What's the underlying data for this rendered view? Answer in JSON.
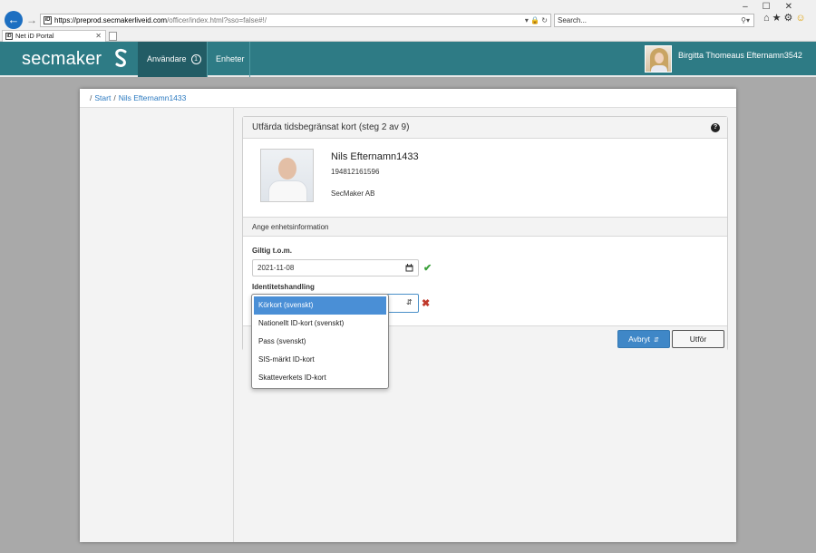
{
  "browser": {
    "url_host": "https://preprod.secmakerliveid.com",
    "url_path": "/officer/index.html?sso=false#!/",
    "search_placeholder": "Search...",
    "tab_title": "Net iD Portal",
    "site_icon_text": "iD"
  },
  "header": {
    "logo_text": "secmaker",
    "nav": [
      {
        "label": "Användare",
        "count": "1"
      },
      {
        "label": "Enheter"
      }
    ],
    "user_name": "Birgitta Thomeaus Efternamn3542"
  },
  "breadcrumb": {
    "items": [
      "Start",
      "Nils Efternamn1433"
    ]
  },
  "panel": {
    "title": "Utfärda tidsbegränsat kort (steg 2 av 9)",
    "help_glyph": "?",
    "person": {
      "name": "Nils Efternamn1433",
      "id_number": "194812161596",
      "organization": "SecMaker AB"
    },
    "section_title": "Ange enhetsinformation",
    "valid_label": "Giltig t.o.m.",
    "valid_value": "2021-11-08",
    "doc_label": "Identitetshandling",
    "buttons": {
      "cancel": "Avbryt",
      "execute": "Utför"
    }
  },
  "dropdown": {
    "options": [
      "Körkort (svenskt)",
      "Nationellt ID-kort (svenskt)",
      "Pass (svenskt)",
      "SIS-märkt ID-kort",
      "Skatteverkets ID-kort"
    ],
    "selected_index": 0
  },
  "colors": {
    "header_bg": "#2e7b85",
    "accent_blue": "#3f87c7",
    "valid_green": "#3aa03a",
    "error_red": "#c0392b"
  }
}
